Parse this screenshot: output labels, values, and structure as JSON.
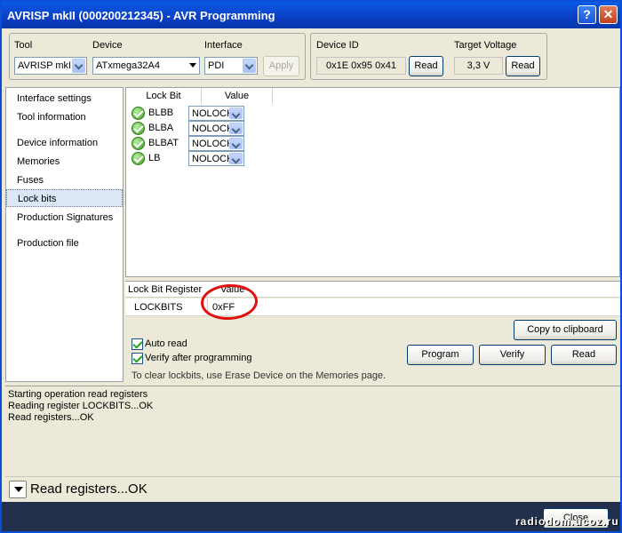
{
  "window": {
    "title": "AVRISP mkII (000200212345) - AVR Programming",
    "help": "?",
    "close": "✕"
  },
  "tool_group": {
    "tool_label": "Tool",
    "tool_value": "AVRISP mkII",
    "device_label": "Device",
    "device_value": "ATxmega32A4",
    "interface_label": "Interface",
    "interface_value": "PDI",
    "apply_label": "Apply"
  },
  "device_group": {
    "device_id_label": "Device ID",
    "device_id_value": "0x1E 0x95 0x41",
    "read_label": "Read",
    "target_voltage_label": "Target Voltage",
    "target_voltage_value": "3,3 V",
    "read2_label": "Read"
  },
  "sidebar": {
    "items": [
      {
        "label": "Interface settings"
      },
      {
        "label": "Tool information"
      },
      {
        "label": "Device information"
      },
      {
        "label": "Memories"
      },
      {
        "label": "Fuses"
      },
      {
        "label": "Lock bits"
      },
      {
        "label": "Production Signatures"
      },
      {
        "label": "Production file"
      }
    ],
    "selected": "Lock bits"
  },
  "lockbits": {
    "col_lockbit": "Lock Bit",
    "col_value": "Value",
    "rows": [
      {
        "name": "BLBB",
        "value": "NOLOCK"
      },
      {
        "name": "BLBA",
        "value": "NOLOCK"
      },
      {
        "name": "BLBAT",
        "value": "NOLOCK"
      },
      {
        "name": "LB",
        "value": "NOLOCK"
      }
    ]
  },
  "register": {
    "col_register": "Lock Bit Register",
    "col_value": "Value",
    "name": "LOCKBITS",
    "value": "0xFF",
    "annotation_color": "#e01010"
  },
  "actions": {
    "copy_label": "Copy to clipboard",
    "auto_read_label": "Auto read",
    "verify_after_label": "Verify after programming",
    "program_label": "Program",
    "verify_label": "Verify",
    "read_label": "Read",
    "hint": "To clear lockbits, use Erase Device on the Memories page."
  },
  "log": {
    "lines": [
      "Starting operation read registers",
      "Reading register LOCKBITS...OK",
      "Read registers...OK"
    ]
  },
  "status": {
    "text": "Read registers...OK"
  },
  "footer": {
    "close_label": "Close",
    "watermark": "radiodom.ucoz.ru"
  },
  "colors": {
    "titlebar": "#0a4fd6",
    "selection": "#dbe6f7",
    "footer": "#22304b"
  }
}
